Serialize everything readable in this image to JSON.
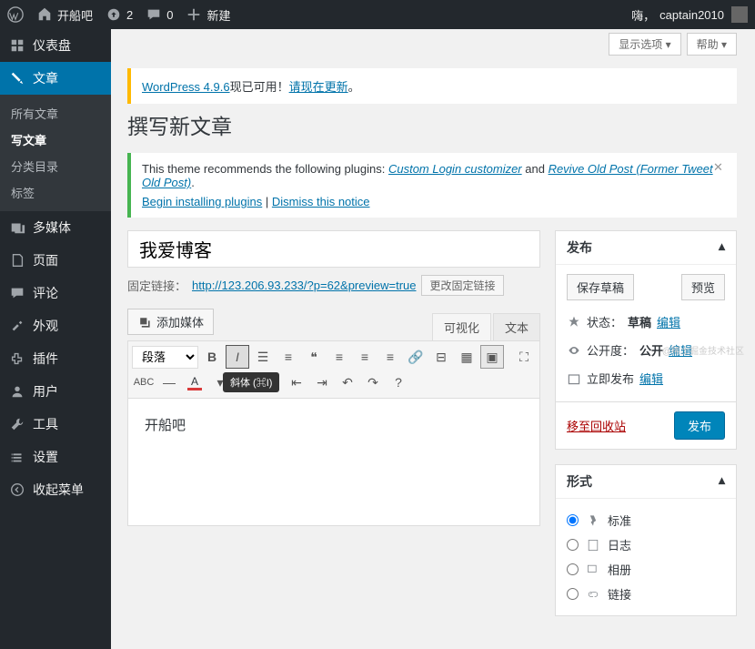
{
  "adminbar": {
    "site_name": "开船吧",
    "updates_count": "2",
    "comments_count": "0",
    "new_label": "新建",
    "greeting": "嗨，",
    "user": "captain2010"
  },
  "sidebar": {
    "dashboard": "仪表盘",
    "posts": "文章",
    "posts_sub": {
      "all": "所有文章",
      "new": "写文章",
      "categories": "分类目录",
      "tags": "标签"
    },
    "media": "多媒体",
    "pages": "页面",
    "comments": "评论",
    "appearance": "外观",
    "plugins": "插件",
    "users": "用户",
    "tools": "工具",
    "settings": "设置",
    "collapse": "收起菜单"
  },
  "screen_meta": {
    "options": "显示选项 ▾",
    "help": "帮助 ▾"
  },
  "update_nag": {
    "prefix": "WordPress 4.9.6",
    "text": "现已可用！",
    "link": "请现在更新",
    "suffix": "。"
  },
  "page_title": "撰写新文章",
  "notice": {
    "text1": "This theme recommends the following plugins: ",
    "link1": "Custom Login customizer",
    "and": " and ",
    "link2": "Revive Old Post (Former Tweet Old Post)",
    "dot": ".",
    "begin": "Begin installing plugins",
    "sep": " | ",
    "dismiss": "Dismiss this notice"
  },
  "editor": {
    "title_value": "我爱博客",
    "permalink_label": "固定链接：",
    "permalink_url": "http://123.206.93.233/?p=62&preview=true",
    "permalink_btn": "更改固定链接",
    "add_media": "添加媒体",
    "tab_visual": "可视化",
    "tab_text": "文本",
    "format_select": "段落",
    "tooltip": "斜体 (⌘I)",
    "body": "开船吧"
  },
  "publish": {
    "title": "发布",
    "save_draft": "保存草稿",
    "preview": "预览",
    "status_label": "状态：",
    "status_value": "草稿",
    "edit": "编辑",
    "visibility_label": "公开度：",
    "visibility_value": "公开",
    "schedule_label": "立即发布",
    "trash": "移至回收站",
    "publish_btn": "发布"
  },
  "format": {
    "title": "形式",
    "options": [
      "标准",
      "日志",
      "相册",
      "链接"
    ]
  },
  "watermark": "@稀土掘金技术社区"
}
